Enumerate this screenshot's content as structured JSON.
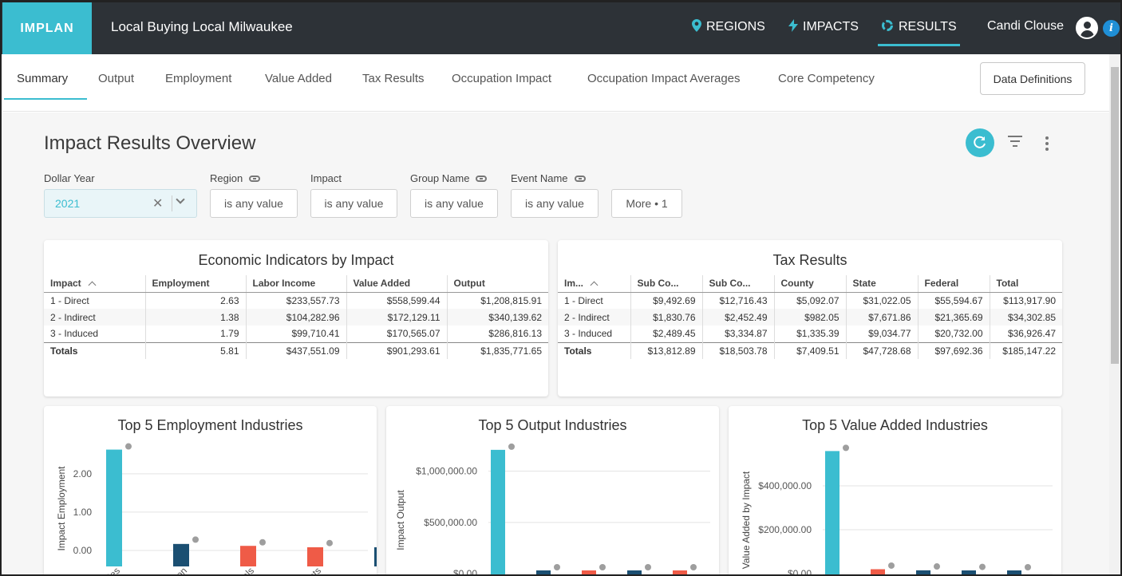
{
  "app": {
    "logo": "IMPLAN",
    "project_title": "Local Buying Local Milwaukee",
    "nav": [
      {
        "label": "REGIONS",
        "icon": "map-pin-icon"
      },
      {
        "label": "IMPACTS",
        "icon": "lightning-icon"
      },
      {
        "label": "RESULTS",
        "icon": "results-icon",
        "active": true
      }
    ],
    "user_name": "Candi Clouse"
  },
  "tabs": [
    "Summary",
    "Output",
    "Employment",
    "Value Added",
    "Tax Results",
    "Occupation Impact",
    "Occupation Impact Averages",
    "Core Competency"
  ],
  "data_definitions_label": "Data Definitions",
  "page_title": "Impact Results Overview",
  "filters": {
    "dollar_year_label": "Dollar Year",
    "dollar_year_value": "2021",
    "region_label": "Region",
    "region_value": "is any value",
    "impact_label": "Impact",
    "impact_value": "is any value",
    "group_label": "Group Name",
    "group_value": "is any value",
    "event_label": "Event Name",
    "event_value": "is any value",
    "more_label": "More • 1"
  },
  "econ_table": {
    "title": "Economic Indicators by Impact",
    "headers": [
      "Impact",
      "Employment",
      "Labor Income",
      "Value Added",
      "Output"
    ],
    "rows": [
      [
        "1 - Direct",
        "2.63",
        "$233,557.73",
        "$558,599.44",
        "$1,208,815.91"
      ],
      [
        "2 - Indirect",
        "1.38",
        "$104,282.96",
        "$172,129.11",
        "$340,139.62"
      ],
      [
        "3 - Induced",
        "1.79",
        "$99,710.41",
        "$170,565.07",
        "$286,816.13"
      ]
    ],
    "totals": [
      "Totals",
      "5.81",
      "$437,551.09",
      "$901,293.61",
      "$1,835,771.65"
    ]
  },
  "tax_table": {
    "title": "Tax Results",
    "headers": [
      "Im...",
      "Sub Co...",
      "Sub Co...",
      "County",
      "State",
      "Federal",
      "Total"
    ],
    "rows": [
      [
        "1 - Direct",
        "$9,492.69",
        "$12,716.43",
        "$5,092.07",
        "$31,022.05",
        "$55,594.67",
        "$113,917.90"
      ],
      [
        "2 - Indirect",
        "$1,830.76",
        "$2,452.49",
        "$982.05",
        "$7,671.86",
        "$21,365.69",
        "$34,302.85"
      ],
      [
        "3 - Induced",
        "$2,489.45",
        "$3,334.87",
        "$1,335.39",
        "$9,034.77",
        "$20,732.00",
        "$36,926.47"
      ]
    ],
    "totals": [
      "Totals",
      "$13,812.89",
      "$18,503.78",
      "$7,409.51",
      "$47,728.68",
      "$97,692.36",
      "$185,147.22"
    ]
  },
  "colors": {
    "accent": "#3bbdd0",
    "direct": "#3bbdd0",
    "indirect": "#1b4f72",
    "induced": "#ef5b47",
    "marker": "#9e9e9e"
  },
  "chart_data": [
    {
      "type": "bar",
      "title": "Top 5 Employment Industries",
      "ylabel": "Impact Employment",
      "ylim": [
        0,
        2.6
      ],
      "yticks": [
        0,
        1,
        2
      ],
      "ytick_labels": [
        "0.00",
        "1.00",
        "2.00"
      ],
      "xtick_labels": [
        "ries",
        "ation",
        "itals",
        "ants",
        "tate"
      ],
      "values": [
        2.63,
        0.17,
        0.12,
        0.06,
        0.03
      ],
      "marker_values": [
        2.63,
        0.2,
        0.13,
        0.11,
        0.09
      ],
      "bar_colors": [
        "#3bbdd0",
        "#1b4f72",
        "#ef5b47",
        "#ef5b47",
        "#1b4f72"
      ]
    },
    {
      "type": "bar",
      "title": "Top 5 Output Industries",
      "ylabel": "Impact Output",
      "ylim": [
        0,
        1200000
      ],
      "yticks": [
        0,
        500000,
        1000000
      ],
      "ytick_labels": [
        "$0.00",
        "$500,000.00",
        "$1,000,000.00"
      ],
      "xtick_labels": [],
      "values": [
        1208815.91,
        30000,
        25000,
        20000,
        15000
      ],
      "marker_values": [
        1208815.91,
        30000,
        28000,
        28000,
        25000
      ],
      "bar_colors": [
        "#3bbdd0",
        "#1b4f72",
        "#ef5b47",
        "#1b4f72",
        "#ef5b47"
      ]
    },
    {
      "type": "bar",
      "title": "Top 5 Value Added Industries",
      "ylabel": "Value Added by Impact",
      "ylim": [
        0,
        560000
      ],
      "yticks": [
        0,
        200000,
        400000
      ],
      "ytick_labels": [
        "$0.00",
        "$200,000.00",
        "$400,000.00"
      ],
      "xtick_labels": [],
      "values": [
        558599.44,
        20000,
        15000,
        12000,
        10000
      ],
      "marker_values": [
        558599.44,
        22000,
        18000,
        16000,
        14000
      ],
      "bar_colors": [
        "#3bbdd0",
        "#ef5b47",
        "#1b4f72",
        "#1b4f72",
        "#1b4f72"
      ]
    }
  ]
}
